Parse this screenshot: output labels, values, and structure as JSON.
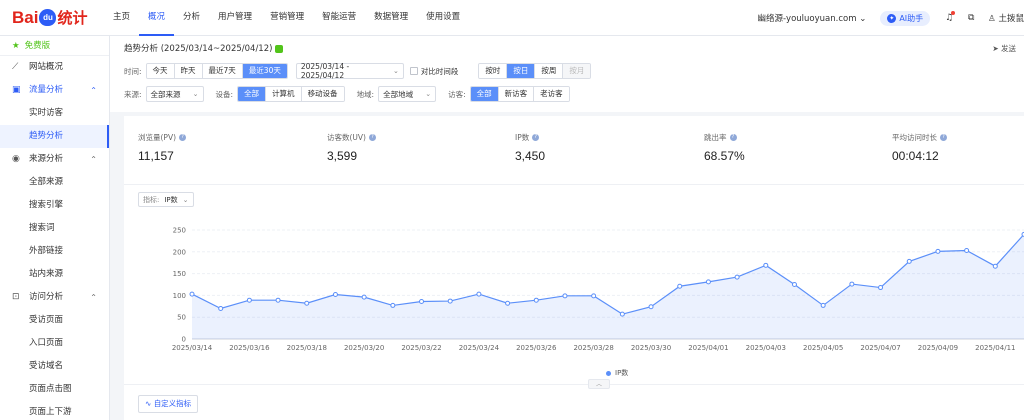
{
  "brand": {
    "part1": "Bai",
    "paw": "du",
    "part2": "统计"
  },
  "topnav": [
    "主页",
    "概况",
    "分析",
    "用户管理",
    "营销管理",
    "智能运营",
    "数据管理",
    "使用设置"
  ],
  "header": {
    "site": "幽络源-youluoyuan.com",
    "ai_label": "AI助手",
    "user": "土拨鼠"
  },
  "sidebar": {
    "free_label": "免费版",
    "items": [
      {
        "label": "网站概况",
        "kind": "group",
        "icon": "line-chart-icon",
        "glyph": "⟋",
        "chev": ""
      },
      {
        "label": "流量分析",
        "kind": "group",
        "icon": "bar-chart-icon",
        "glyph": "▣",
        "chev": "⌃",
        "open": true
      },
      {
        "label": "实时访客",
        "kind": "sub"
      },
      {
        "label": "趋势分析",
        "kind": "sub",
        "active": true
      },
      {
        "label": "来源分析",
        "kind": "group",
        "icon": "globe-icon",
        "glyph": "◉",
        "chev": "⌃"
      },
      {
        "label": "全部来源",
        "kind": "sub"
      },
      {
        "label": "搜索引擎",
        "kind": "sub"
      },
      {
        "label": "搜索词",
        "kind": "sub"
      },
      {
        "label": "外部链接",
        "kind": "sub"
      },
      {
        "label": "站内来源",
        "kind": "sub"
      },
      {
        "label": "访问分析",
        "kind": "group",
        "icon": "download-box-icon",
        "glyph": "⊡",
        "chev": "⌃"
      },
      {
        "label": "受访页面",
        "kind": "sub"
      },
      {
        "label": "入口页面",
        "kind": "sub"
      },
      {
        "label": "受访域名",
        "kind": "sub"
      },
      {
        "label": "页面点击图",
        "kind": "sub"
      },
      {
        "label": "页面上下游",
        "kind": "sub"
      }
    ]
  },
  "page": {
    "title": "趋势分析 (2025/03/14~2025/04/12)",
    "share": "发送"
  },
  "filters": {
    "time_label": "时间:",
    "time_buttons": [
      {
        "label": "今天"
      },
      {
        "label": "昨天"
      },
      {
        "label": "最近7天"
      },
      {
        "label": "最近30天",
        "on": true
      }
    ],
    "date_range": "2025/03/14 - 2025/04/12",
    "compare_label": "对比时间段",
    "granularity": [
      {
        "label": "按时"
      },
      {
        "label": "按日",
        "on": true
      },
      {
        "label": "按周"
      },
      {
        "label": "按月",
        "off": true
      }
    ],
    "source_label": "来源:",
    "source_value": "全部来源",
    "device_label": "设备:",
    "device_buttons": [
      {
        "label": "全部",
        "on": true
      },
      {
        "label": "计算机"
      },
      {
        "label": "移动设备"
      }
    ],
    "region_label": "地域:",
    "region_value": "全部地域",
    "visitor_label": "访客:",
    "visitor_buttons": [
      {
        "label": "全部",
        "on": true
      },
      {
        "label": "新访客"
      },
      {
        "label": "老访客"
      }
    ]
  },
  "metrics": [
    {
      "label": "浏览量(PV)",
      "value": "11,157"
    },
    {
      "label": "访客数(UV)",
      "value": "3,599"
    },
    {
      "label": "IP数",
      "value": "3,450"
    },
    {
      "label": "跳出率",
      "value": "68.57%"
    },
    {
      "label": "平均访问时长",
      "value": "00:04:12"
    }
  ],
  "indicator": {
    "label": "指标:",
    "value": "IP数"
  },
  "custom_button": "自定义指标",
  "colors": {
    "accent": "#2d5cf6",
    "series": "#5b8ff9",
    "free": "#52c41a"
  },
  "chart_data": {
    "type": "area",
    "x": [
      "2025/03/14",
      "2025/03/15",
      "2025/03/16",
      "2025/03/17",
      "2025/03/18",
      "2025/03/19",
      "2025/03/20",
      "2025/03/21",
      "2025/03/22",
      "2025/03/23",
      "2025/03/24",
      "2025/03/25",
      "2025/03/26",
      "2025/03/27",
      "2025/03/28",
      "2025/03/29",
      "2025/03/30",
      "2025/03/31",
      "2025/04/01",
      "2025/04/02",
      "2025/04/03",
      "2025/04/04",
      "2025/04/05",
      "2025/04/06",
      "2025/04/07",
      "2025/04/08",
      "2025/04/09",
      "2025/04/10",
      "2025/04/11",
      "2025/04/12"
    ],
    "x_tick_labels": [
      "2025/03/14",
      "2025/03/16",
      "2025/03/18",
      "2025/03/20",
      "2025/03/22",
      "2025/03/24",
      "2025/03/26",
      "2025/03/28",
      "2025/03/30",
      "2025/04/01",
      "2025/04/03",
      "2025/04/05",
      "2025/04/07",
      "2025/04/09",
      "2025/04/11"
    ],
    "series": [
      {
        "name": "IP数",
        "values": [
          103,
          70,
          89,
          89,
          82,
          102,
          96,
          77,
          86,
          87,
          103,
          82,
          89,
          99,
          99,
          57,
          74,
          121,
          131,
          142,
          169,
          125,
          77,
          126,
          118,
          178,
          201,
          203,
          167,
          240
        ]
      }
    ],
    "ylim": [
      0,
      250
    ],
    "yticks": [
      0,
      50,
      100,
      150,
      200,
      250
    ],
    "grid": true,
    "legend": "bottom"
  }
}
